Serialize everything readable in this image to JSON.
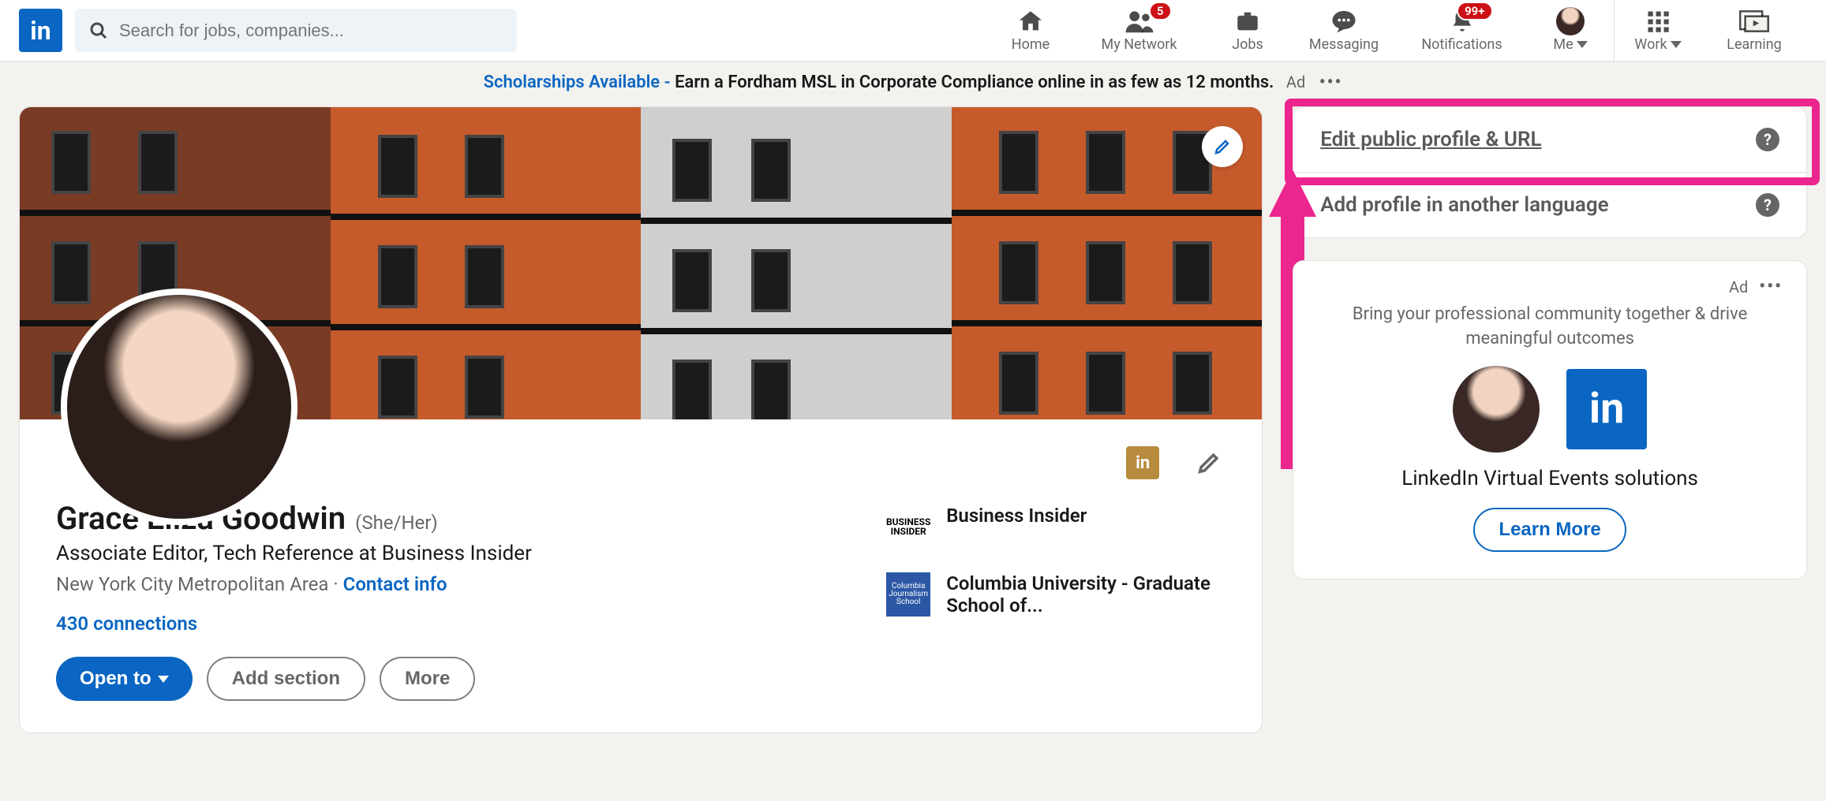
{
  "nav": {
    "search_placeholder": "Search for jobs, companies...",
    "items": [
      {
        "key": "home",
        "label": "Home"
      },
      {
        "key": "network",
        "label": "My Network",
        "badge": "5"
      },
      {
        "key": "jobs",
        "label": "Jobs"
      },
      {
        "key": "messaging",
        "label": "Messaging"
      },
      {
        "key": "notifications",
        "label": "Notifications",
        "badge": "99+"
      },
      {
        "key": "me",
        "label": "Me"
      },
      {
        "key": "work",
        "label": "Work"
      },
      {
        "key": "learning",
        "label": "Learning"
      }
    ]
  },
  "banner": {
    "link_text": "Scholarships Available - ",
    "text": "Earn a Fordham MSL in Corporate Compliance online in as few as 12 months.",
    "ad_label": "Ad"
  },
  "profile": {
    "name": "Grace Eliza Goodwin",
    "pronouns": "(She/Her)",
    "headline": "Associate Editor, Tech Reference at Business Insider",
    "location": "New York City Metropolitan Area",
    "contact_info_label": "Contact info",
    "connections": "430 connections",
    "buttons": {
      "open_to": "Open to",
      "add_section": "Add section",
      "more": "More"
    },
    "experience": [
      {
        "name": "Business Insider",
        "logo_top": "BUSINESS",
        "logo_bottom": "INSIDER"
      },
      {
        "name": "Columbia University - Graduate School of...",
        "logo_text": "Columbia Journalism School"
      }
    ]
  },
  "sidebar": {
    "edit_profile": "Edit public profile & URL",
    "add_language": "Add profile in another language"
  },
  "ad_card": {
    "ad_label": "Ad",
    "text": "Bring your professional community together & drive meaningful outcomes",
    "title": "LinkedIn Virtual Events solutions",
    "button": "Learn More"
  },
  "colors": {
    "primary": "#0a66c2",
    "highlight": "#ec268f"
  }
}
